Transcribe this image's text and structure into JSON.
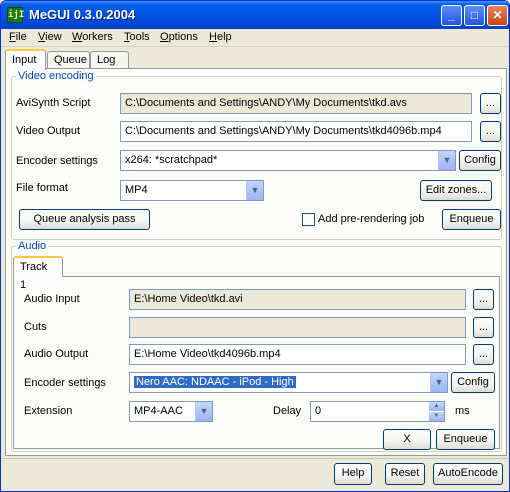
{
  "window": {
    "title": "MeGUI 0.3.0.2004",
    "icon_text": "ijI"
  },
  "title_buttons": {
    "minimize": "_",
    "maximize": "□",
    "close": "✕"
  },
  "menu": [
    {
      "label": "File",
      "accel": "F",
      "rest": "ile"
    },
    {
      "label": "View",
      "accel": "V",
      "rest": "iew"
    },
    {
      "label": "Workers",
      "accel": "W",
      "rest": "orkers"
    },
    {
      "label": "Tools",
      "accel": "T",
      "rest": "ools"
    },
    {
      "label": "Options",
      "accel": "O",
      "rest": "ptions"
    },
    {
      "label": "Help",
      "accel": "H",
      "rest": "elp"
    }
  ],
  "tabs": [
    "Input",
    "Queue",
    "Log"
  ],
  "video": {
    "group_title": "Video encoding",
    "avisynth_label": "AviSynth Script",
    "avisynth_value": "C:\\Documents and Settings\\ANDY\\My Documents\\tkd.avs",
    "output_label": "Video Output",
    "output_value": "C:\\Documents and Settings\\ANDY\\My Documents\\tkd4096b.mp4",
    "encoder_label": "Encoder settings",
    "encoder_value": "x264: *scratchpad*",
    "config_label": "Config",
    "format_label": "File format",
    "format_value": "MP4",
    "edit_zones_label": "Edit zones...",
    "queue_analysis_label": "Queue analysis pass",
    "prerender_label": "Add pre-rendering job",
    "enqueue_label": "Enqueue",
    "browse_label": "..."
  },
  "audio": {
    "group_title": "Audio",
    "track_tab": "Track 1",
    "input_label": "Audio Input",
    "input_value": "E:\\Home Video\\tkd.avi",
    "cuts_label": "Cuts",
    "cuts_value": "",
    "output_label": "Audio Output",
    "output_value": "E:\\Home Video\\tkd4096b.mp4",
    "encoder_label": "Encoder settings",
    "encoder_value": "Nero AAC: NDAAC - iPod - High",
    "config_label": "Config",
    "extension_label": "Extension",
    "extension_value": "MP4-AAC",
    "delay_label": "Delay",
    "delay_value": "0",
    "delay_unit": "ms",
    "clear_label": "X",
    "enqueue_label": "Enqueue",
    "browse_label": "..."
  },
  "footer": {
    "help_label": "Help",
    "reset_label": "Reset",
    "autoencode_label": "AutoEncode"
  },
  "colors": {
    "title_blue": "#0055e5",
    "group_title": "#0046d5",
    "selection": "#316ac5",
    "tab_highlight": "#ffc83c"
  }
}
